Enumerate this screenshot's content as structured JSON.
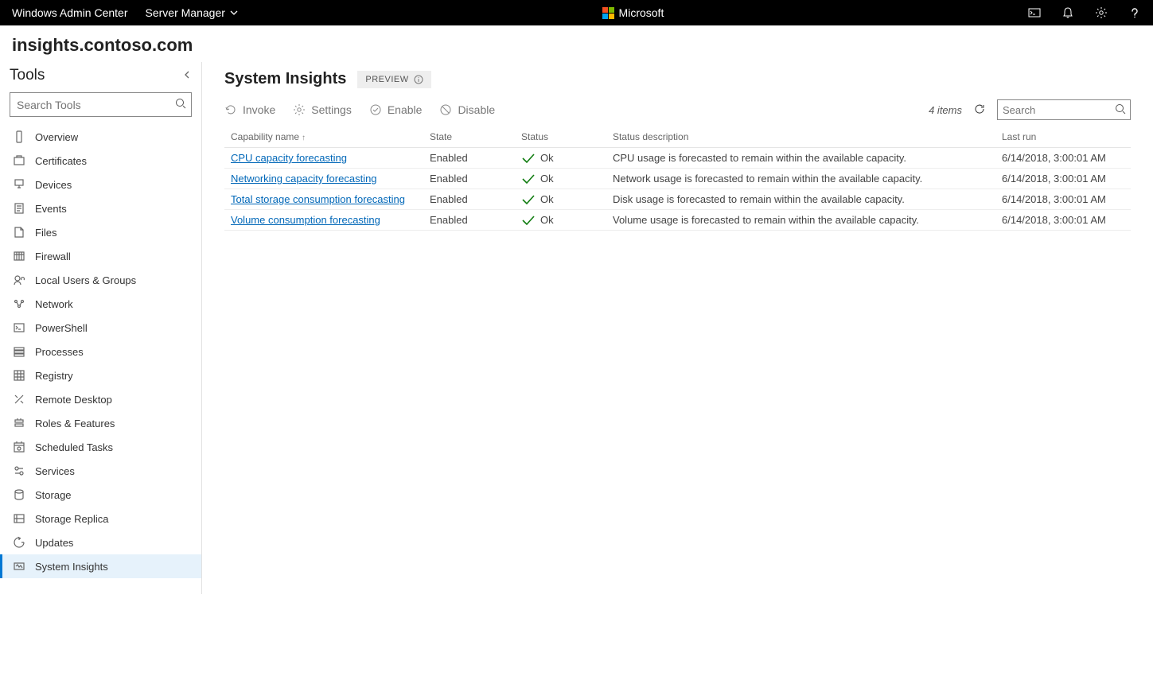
{
  "topbar": {
    "title": "Windows Admin Center",
    "dropdown": "Server Manager",
    "brand": "Microsoft"
  },
  "host": {
    "name": "insights.contoso.com"
  },
  "sidebar": {
    "title": "Tools",
    "search_placeholder": "Search Tools",
    "items": [
      {
        "label": "Overview"
      },
      {
        "label": "Certificates"
      },
      {
        "label": "Devices"
      },
      {
        "label": "Events"
      },
      {
        "label": "Files"
      },
      {
        "label": "Firewall"
      },
      {
        "label": "Local Users & Groups"
      },
      {
        "label": "Network"
      },
      {
        "label": "PowerShell"
      },
      {
        "label": "Processes"
      },
      {
        "label": "Registry"
      },
      {
        "label": "Remote Desktop"
      },
      {
        "label": "Roles & Features"
      },
      {
        "label": "Scheduled Tasks"
      },
      {
        "label": "Services"
      },
      {
        "label": "Storage"
      },
      {
        "label": "Storage Replica"
      },
      {
        "label": "Updates"
      },
      {
        "label": "System Insights",
        "active": true
      }
    ]
  },
  "page": {
    "title": "System Insights",
    "preview": "PREVIEW"
  },
  "toolbar": {
    "invoke": "Invoke",
    "settings": "Settings",
    "enable": "Enable",
    "disable": "Disable",
    "items_count": "4 items",
    "search_placeholder": "Search"
  },
  "table": {
    "columns": {
      "name": "Capability name",
      "state": "State",
      "status": "Status",
      "desc": "Status description",
      "last": "Last run"
    },
    "rows": [
      {
        "name": "CPU capacity forecasting",
        "state": "Enabled",
        "status": "Ok",
        "desc": "CPU usage is forecasted to remain within the available capacity.",
        "last": "6/14/2018, 3:00:01 AM"
      },
      {
        "name": "Networking capacity forecasting",
        "state": "Enabled",
        "status": "Ok",
        "desc": "Network usage is forecasted to remain within the available capacity.",
        "last": "6/14/2018, 3:00:01 AM"
      },
      {
        "name": "Total storage consumption forecasting",
        "state": "Enabled",
        "status": "Ok",
        "desc": "Disk usage is forecasted to remain within the available capacity.",
        "last": "6/14/2018, 3:00:01 AM"
      },
      {
        "name": "Volume consumption forecasting",
        "state": "Enabled",
        "status": "Ok",
        "desc": "Volume usage is forecasted to remain within the available capacity.",
        "last": "6/14/2018, 3:00:01 AM"
      }
    ]
  }
}
